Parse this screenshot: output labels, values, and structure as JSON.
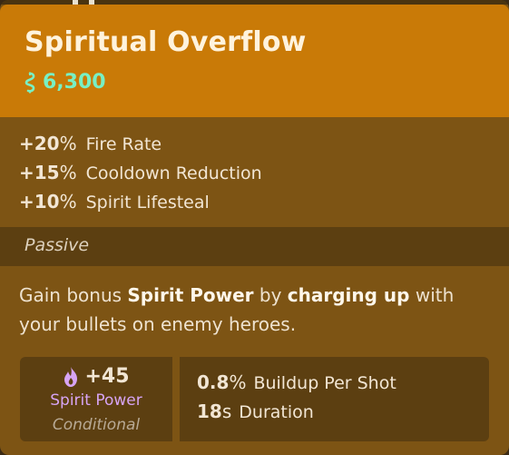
{
  "item": {
    "title": "Spiritual Overflow",
    "cost": "6,300",
    "cost_icon": "souls-icon",
    "cost_color": "#78f0c4",
    "header_color": "#c97a07"
  },
  "stats": [
    {
      "value": "+20",
      "unit": "%",
      "label": "Fire Rate"
    },
    {
      "value": "+15",
      "unit": "%",
      "label": "Cooldown Reduction"
    },
    {
      "value": "+10",
      "unit": "%",
      "label": "Spirit Lifesteal"
    }
  ],
  "passive": {
    "label": "Passive",
    "description": {
      "p1": "Gain bonus ",
      "b1": "Spirit Power",
      "p2": " by ",
      "b2": "charging up",
      "p3": " with your bullets on enemy heroes."
    },
    "spirit_power": {
      "icon": "spirit-flame-icon",
      "value": "+45",
      "name": "Spirit Power",
      "condition": "Conditional",
      "color": "#d7a4f4"
    },
    "properties": [
      {
        "value": "0.8",
        "unit": "%",
        "label": "Buildup Per Shot"
      },
      {
        "value": "18",
        "unit": "s",
        "label": "Duration"
      }
    ]
  }
}
